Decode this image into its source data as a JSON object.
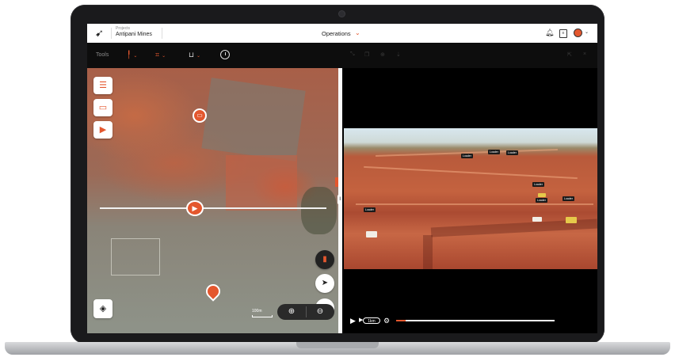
{
  "header": {
    "project_label": "Projects",
    "project_name": "Antipani Mines",
    "view_selector": "Operations"
  },
  "toolbar": {
    "label": "Tools"
  },
  "map": {
    "scale_label": "100m"
  },
  "video": {
    "speed_label": "1km",
    "progress": 0.06,
    "tags": [
      "Loader",
      "Loader",
      "Loader",
      "Loader",
      "Loader",
      "Loader",
      "Loader"
    ]
  },
  "colors": {
    "accent": "#e4572e",
    "toolbar_bg": "#0d0d0d",
    "header_bg": "#ffffff"
  },
  "icons": {
    "logo": "bird-logo-icon",
    "notification": "bell-icon",
    "document": "document-icon",
    "avatar": "user-avatar",
    "measure": "pin-tool-icon",
    "frame": "frame-tool-icon",
    "ruler": "ruler-tool-icon",
    "clock": "clock-icon"
  }
}
